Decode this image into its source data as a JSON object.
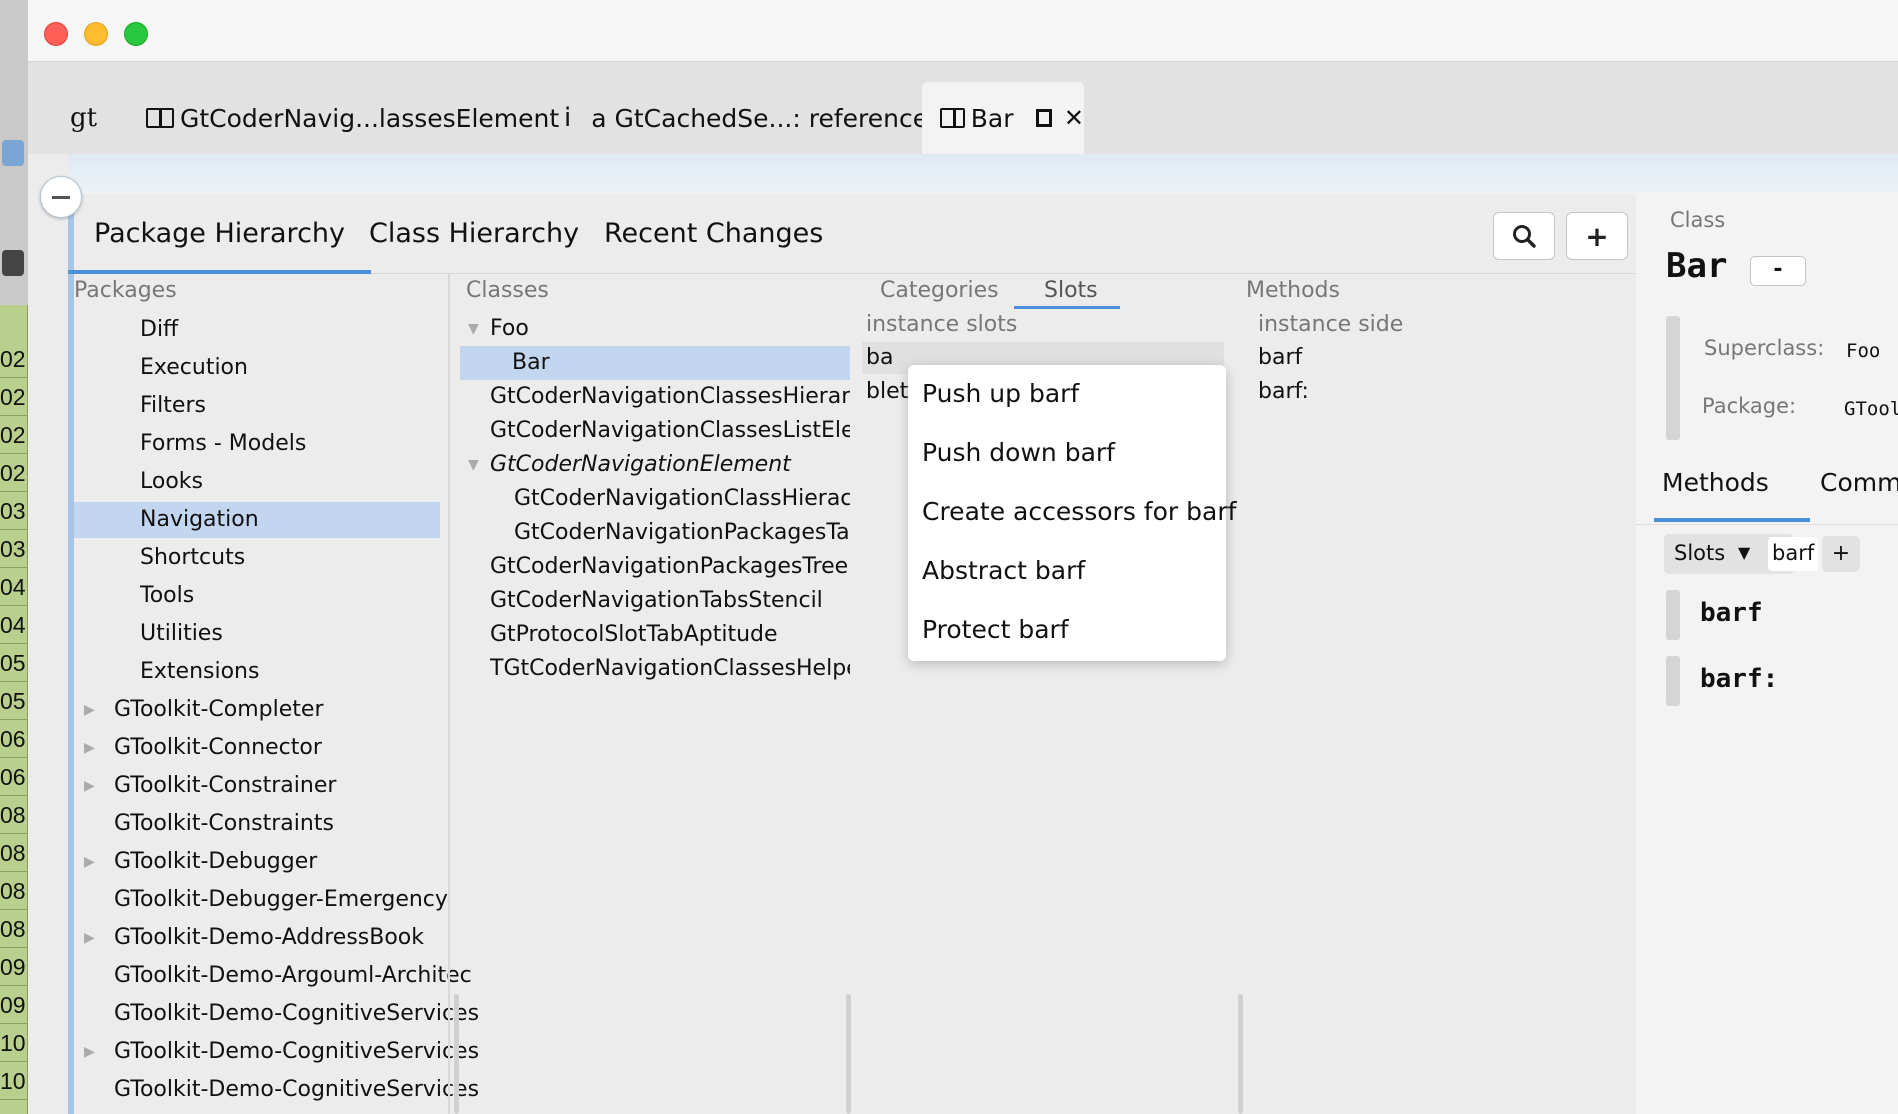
{
  "desktop": {
    "numbers": [
      "02",
      "02",
      "02",
      "02",
      "03",
      "03",
      "04",
      "04",
      "05",
      "05",
      "06",
      "06",
      "08",
      "08",
      "08",
      "08",
      "09",
      "09",
      "10",
      "10"
    ]
  },
  "tabs": [
    {
      "label": "gt"
    },
    {
      "label": "GtCoderNavig...lassesElement"
    },
    {
      "glyph": "i",
      "label": "a GtCachedSe...: references)"
    },
    {
      "label": "Bar"
    }
  ],
  "nav_tabs": [
    "Package Hierarchy",
    "Class Hierarchy",
    "Recent Changes"
  ],
  "buttons": {
    "search": "search-icon",
    "add": "+"
  },
  "packages": {
    "header": "Packages",
    "items": [
      "Diff",
      "Execution",
      "Filters",
      "Forms - Models",
      "Looks",
      "Navigation",
      "Shortcuts",
      "Tools",
      "Utilities",
      "Extensions",
      "GToolkit-Completer",
      "GToolkit-Connector",
      "GToolkit-Constrainer",
      "GToolkit-Constraints",
      "GToolkit-Debugger",
      "GToolkit-Debugger-Emergency",
      "GToolkit-Demo-AddressBook",
      "GToolkit-Demo-Argouml-Architec",
      "GToolkit-Demo-CognitiveServices",
      "GToolkit-Demo-CognitiveServices",
      "GToolkit-Demo-CognitiveServices"
    ],
    "selected": "Navigation"
  },
  "classes": {
    "header": "Classes",
    "items": [
      "Foo",
      "Bar",
      "GtCoderNavigationClassesHierarchy",
      "GtCoderNavigationClassesListEleme",
      "GtCoderNavigationElement",
      "GtCoderNavigationClassHierachy",
      "GtCoderNavigationPackagesTags",
      "GtCoderNavigationPackagesTreeEle",
      "GtCoderNavigationTabsStencil",
      "GtProtocolSlotTabAptitude",
      "TGtCoderNavigationClassesHelper"
    ],
    "selected": "Bar"
  },
  "slots_panel": {
    "tab_categories": "Categories",
    "tab_slots": "Slots",
    "subheader": "instance slots",
    "rows": [
      "ba",
      "blet"
    ]
  },
  "methods_panel": {
    "header": "Methods",
    "subheader": "instance side",
    "items": [
      "barf",
      "barf:"
    ]
  },
  "context_menu": [
    "Push up barf",
    "Push down barf",
    "Create accessors for barf",
    "Abstract barf",
    "Protect barf"
  ],
  "class_panel": {
    "label": "Class",
    "name": "Bar",
    "collapse": "-",
    "superclass_label": "Superclass:",
    "superclass": "Foo",
    "package_label": "Package:",
    "package": "GTool",
    "tabs": [
      "Methods",
      "Comm"
    ],
    "filter_label": "Slots",
    "filter_value": "barf",
    "filter_add": "+",
    "methods": [
      "barf",
      "barf:"
    ]
  }
}
